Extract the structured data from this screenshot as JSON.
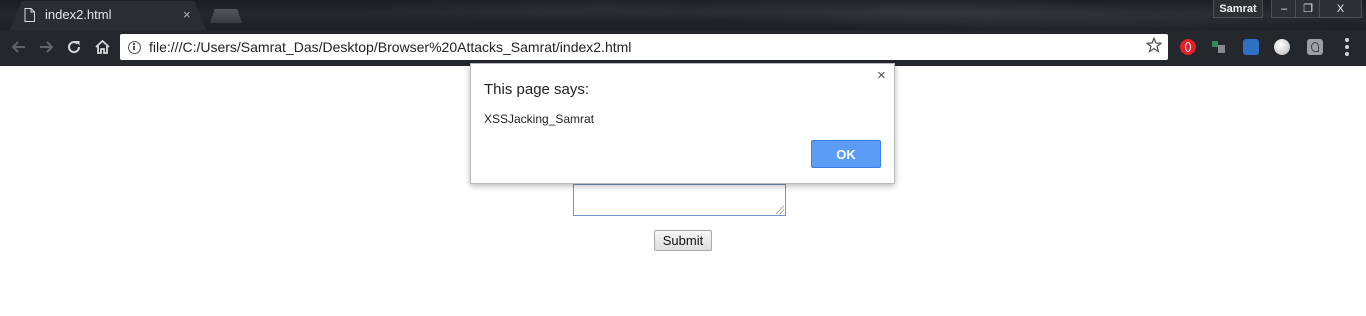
{
  "browser": {
    "tab": {
      "title": "index2.html",
      "close_glyph": "×"
    },
    "profile_name": "Samrat",
    "window_controls": {
      "minimize": "–",
      "maximize": "❐",
      "close": "X"
    },
    "address_bar": {
      "url": "file:///C:/Users/Samrat_Das/Desktop/Browser%20Attacks_Samrat/index2.html"
    },
    "extensions": [
      "opera-icon",
      "javascript-toggle-icon",
      "clapperboard-icon",
      "globe-icon",
      "pdf-icon"
    ]
  },
  "page": {
    "submit_label": "Submit"
  },
  "dialog": {
    "title": "This page says:",
    "message": "XSSJacking_Samrat",
    "ok_label": "OK",
    "close_glyph": "×"
  },
  "colors": {
    "ok_button": "#5b9cf7",
    "textarea_focus_border": "#6f96c9",
    "chrome_dark": "#24282d"
  }
}
